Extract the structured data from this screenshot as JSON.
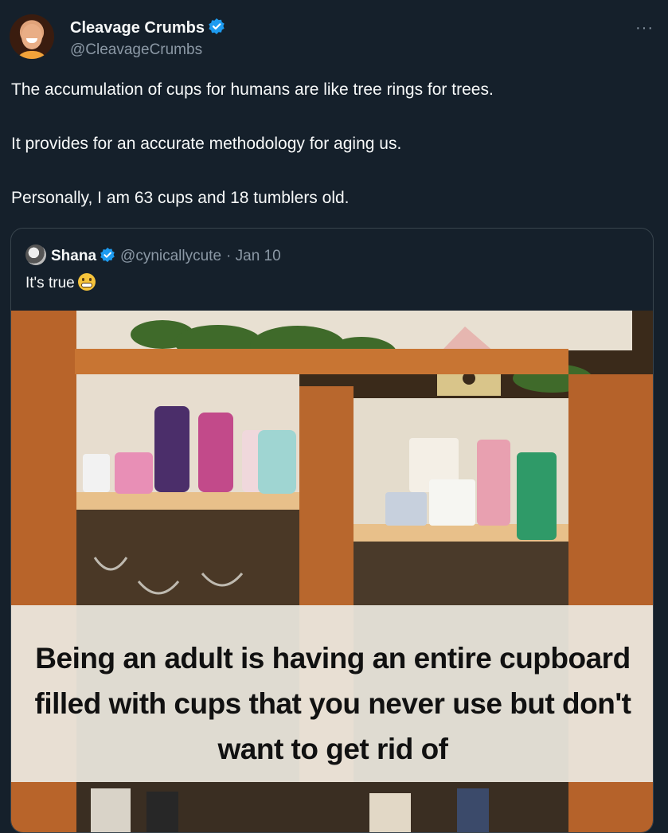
{
  "tweet": {
    "display_name": "Cleavage Crumbs",
    "handle": "@CleavageCrumbs",
    "more_label": "···",
    "paragraphs": [
      "The accumulation of cups for humans are like tree rings for trees.",
      "It provides for an accurate methodology for aging us.",
      "Personally, I am 63 cups and 18 tumblers old."
    ]
  },
  "quoted": {
    "display_name": "Shana",
    "handle": "@cynicallycute",
    "date": "· Jan 10",
    "text": "It's true",
    "emoji": "grimacing-face-icon",
    "image_caption": "Being an adult is having an entire cupboard filled with cups that you never use but don't want to get rid of"
  },
  "colors": {
    "background": "#15202b",
    "primary_text": "#f7f9f9",
    "secondary_text": "#8b98a5",
    "verified_badge": "#1d9bf0",
    "border": "#38444d"
  },
  "icons": {
    "verified": "verified-badge-icon",
    "more": "more-options-icon"
  }
}
